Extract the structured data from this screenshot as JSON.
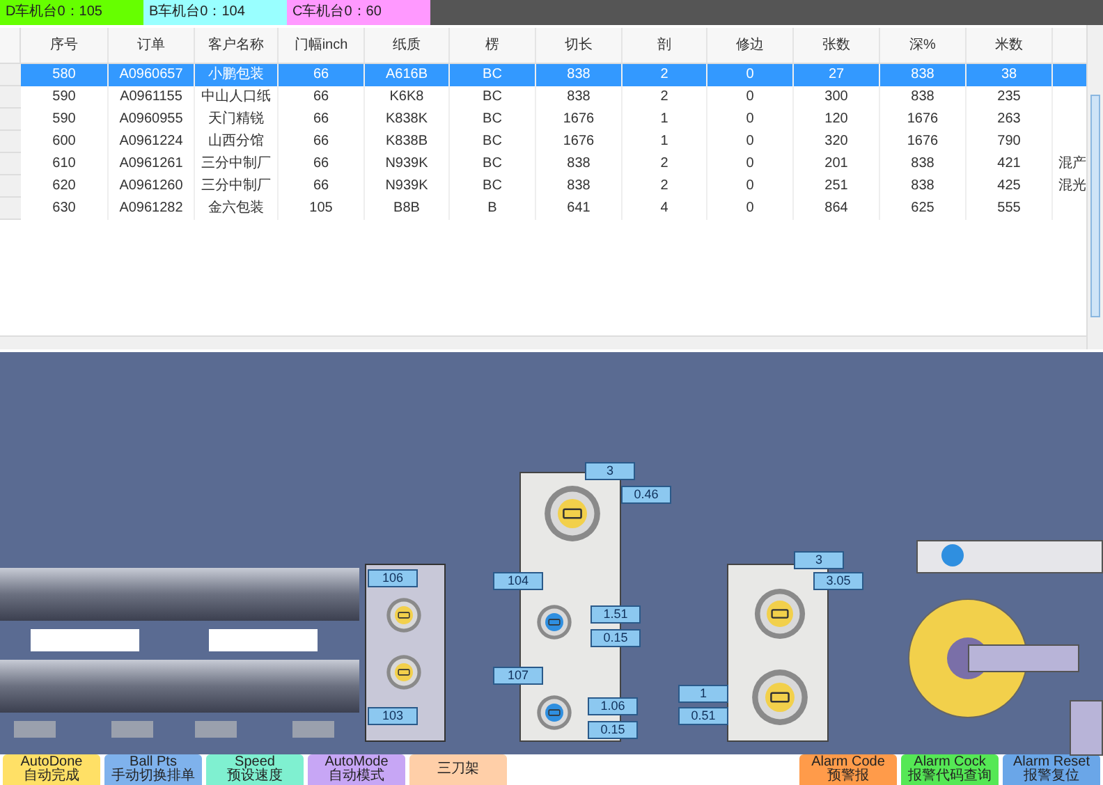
{
  "counters": [
    {
      "text": "D车机台0：105",
      "color": "#66ff00"
    },
    {
      "text": "B车机台0：104",
      "color": "#99ffff"
    },
    {
      "text": "C车机台0：60",
      "color": "#ff99ff"
    }
  ],
  "table": {
    "columns": [
      "序号",
      "订单",
      "客户名称",
      "门幅inch",
      "纸质",
      "楞",
      "切长",
      "剖",
      "修边",
      "张数",
      "深%",
      "米数"
    ],
    "rows": [
      {
        "selected": true,
        "cells": [
          "580",
          "A0960657",
          "小鹏包装",
          "66",
          "A616B",
          "BC",
          "838",
          "2",
          "0",
          "27",
          "838",
          "38"
        ]
      },
      {
        "selected": false,
        "cells": [
          "590",
          "A0961155",
          "中山人口纸",
          "66",
          "K6K8",
          "BC",
          "838",
          "2",
          "0",
          "300",
          "838",
          "235"
        ]
      },
      {
        "selected": false,
        "cells": [
          "590",
          "A0960955",
          "天门精锐",
          "66",
          "K838K",
          "BC",
          "1676",
          "1",
          "0",
          "120",
          "1676",
          "263"
        ]
      },
      {
        "selected": false,
        "cells": [
          "600",
          "A0961224",
          "山西分馆",
          "66",
          "K838B",
          "BC",
          "1676",
          "1",
          "0",
          "320",
          "1676",
          "790"
        ]
      },
      {
        "selected": false,
        "cells": [
          "610",
          "A0961261",
          "三分中制厂",
          "66",
          "N939K",
          "BC",
          "838",
          "2",
          "0",
          "201",
          "838",
          "421"
        ],
        "note": "混产"
      },
      {
        "selected": false,
        "cells": [
          "620",
          "A0961260",
          "三分中制厂",
          "66",
          "N939K",
          "BC",
          "838",
          "2",
          "0",
          "251",
          "838",
          "425"
        ],
        "note": "混光"
      },
      {
        "selected": false,
        "cells": [
          "630",
          "A0961282",
          "金六包装",
          "105",
          "B8B",
          "B",
          "641",
          "4",
          "0",
          "864",
          "625",
          "555"
        ]
      }
    ]
  },
  "diagram": {
    "labels": [
      "106",
      "103",
      "3",
      "0.46",
      "104",
      "1.51",
      "0.15",
      "107",
      "1.06",
      "0.15",
      "3",
      "3.05",
      "1",
      "0.51"
    ],
    "knobs": [
      {
        "color": "#f2d04b"
      },
      {
        "color": "#f2d04b"
      },
      {
        "color": "#f2d04b"
      },
      {
        "color": "#2f8fe0"
      },
      {
        "color": "#2f8fe0"
      },
      {
        "color": "#f2d04b"
      },
      {
        "color": "#f2d04b"
      }
    ]
  },
  "buttons": [
    {
      "lines": [
        "AutoDone",
        "自动完成"
      ],
      "color": "#ffe066"
    },
    {
      "lines": [
        "Ball Pts",
        "手动切换排单"
      ],
      "color": "#7fb2ec"
    },
    {
      "lines": [
        "Speed",
        "预设速度"
      ],
      "color": "#7ff0d0"
    },
    {
      "lines": [
        "AutoMode",
        "自动模式"
      ],
      "color": "#c7a6f5"
    },
    {
      "lines": [
        "三刀架"
      ],
      "color": "#ffcfa8"
    },
    {
      "lines": [
        "Alarm Code",
        "预警报"
      ],
      "color": "#ff9b4a"
    },
    {
      "lines": [
        "Alarm Cock",
        "报警代码查询"
      ],
      "color": "#55e855"
    },
    {
      "lines": [
        "Alarm Reset",
        "报警复位"
      ],
      "color": "#6aa6e8"
    }
  ]
}
